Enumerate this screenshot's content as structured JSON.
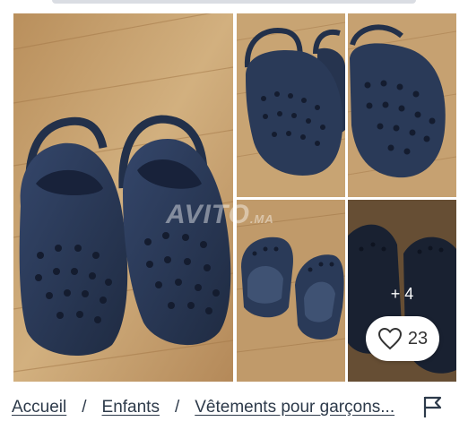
{
  "gallery": {
    "watermark_main": "AVITO",
    "watermark_suffix": ".MA",
    "more_photos": "+ 4",
    "likes": "23"
  },
  "breadcrumb": {
    "items": [
      "Accueil",
      "Enfants",
      "Vêtements pour garçons..."
    ],
    "separator": "/"
  },
  "icons": {
    "like": "heart-icon",
    "report": "flag-icon"
  },
  "colors": {
    "shoe": "#273650",
    "wood": "#c9a679",
    "text": "#2d3a4a"
  }
}
